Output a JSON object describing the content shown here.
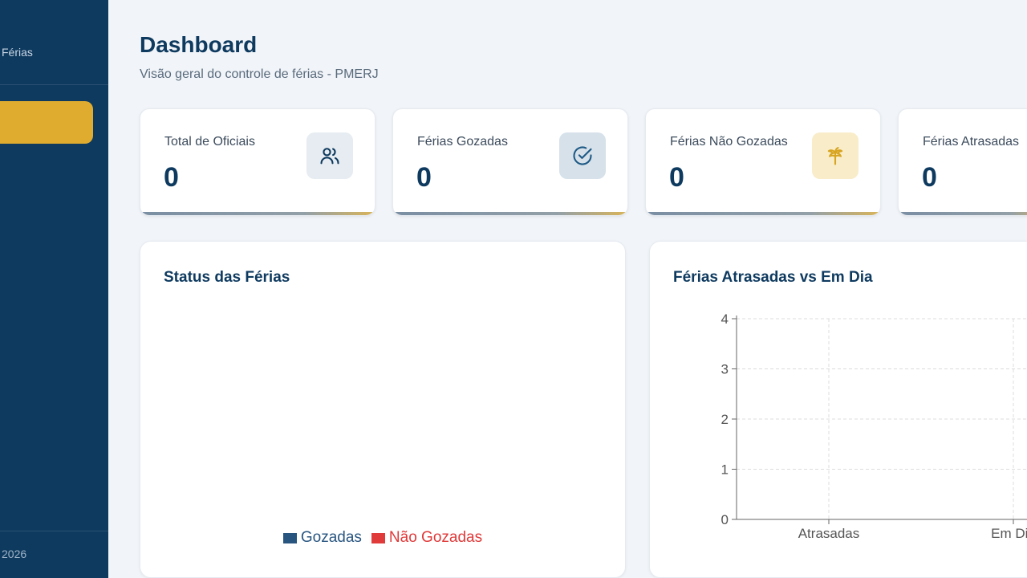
{
  "sidebar": {
    "brand_sub": "Férias",
    "footer": "2026"
  },
  "header": {
    "title": "Dashboard",
    "subtitle": "Visão geral do controle de férias - PMERJ"
  },
  "stats": [
    {
      "label": "Total de Oficiais",
      "value": "0",
      "icon": "users-icon",
      "icon_bg": "#e6ecf1",
      "icon_color": "#0e3a5f"
    },
    {
      "label": "Férias Gozadas",
      "value": "0",
      "icon": "check-circle-icon",
      "icon_bg": "#d6e1ea",
      "icon_color": "#1e5a86"
    },
    {
      "label": "Férias Não Gozadas",
      "value": "0",
      "icon": "palm-tree-icon",
      "icon_bg": "#f8ecc9",
      "icon_color": "#d8a522"
    },
    {
      "label": "Férias Atrasadas",
      "value": "0",
      "icon": "alert-icon",
      "icon_bg": "#f6dede",
      "icon_color": "#d83a3a"
    }
  ],
  "panels": {
    "status": {
      "title": "Status das Férias",
      "legend": [
        {
          "label": "Gozadas",
          "color": "#285580"
        },
        {
          "label": "Não Gozadas",
          "color": "#e03a3a"
        }
      ]
    },
    "late": {
      "title": "Férias Atrasadas vs Em Dia"
    }
  },
  "chart_data": {
    "type": "bar",
    "categories": [
      "Atrasadas",
      "Em Dia"
    ],
    "values": [
      0,
      0
    ],
    "ylim": [
      0,
      4
    ],
    "yticks": [
      "0",
      "1",
      "2",
      "3",
      "4"
    ],
    "grid": true
  }
}
